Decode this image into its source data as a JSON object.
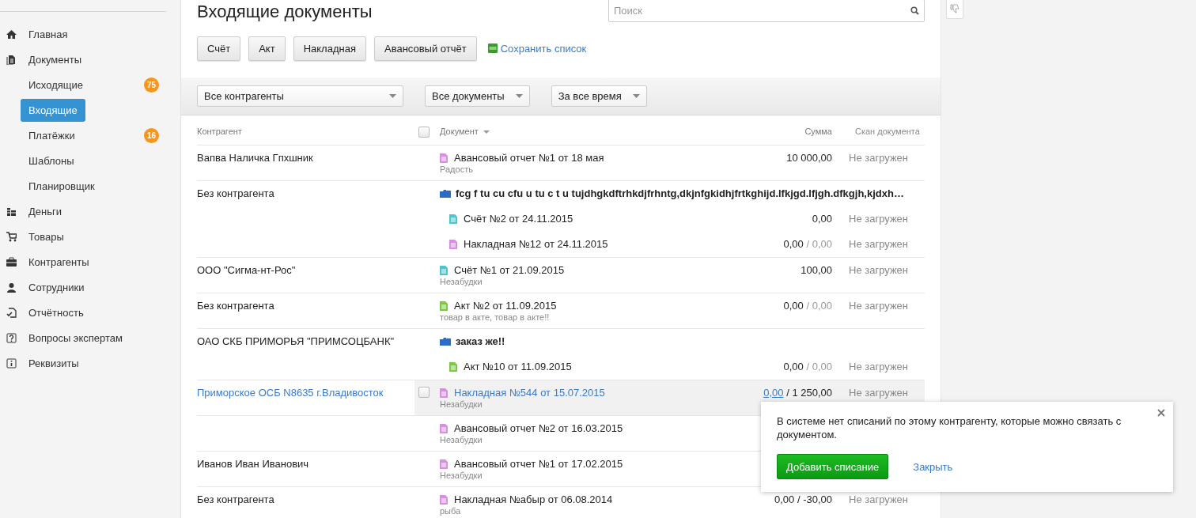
{
  "sidebar": {
    "items": [
      {
        "label": "Главная",
        "selected": false
      },
      {
        "label": "Документы",
        "selected": false,
        "children": [
          {
            "label": "Исходящие",
            "selected": false,
            "count": "75"
          },
          {
            "label": "Входящие",
            "selected": true
          },
          {
            "label": "Платёжки",
            "selected": false,
            "count": "16"
          },
          {
            "label": "Шаблоны",
            "selected": false
          },
          {
            "label": "Планировщик",
            "selected": false
          }
        ]
      },
      {
        "label": "Деньги",
        "selected": false
      },
      {
        "label": "Товары",
        "selected": false
      },
      {
        "label": "Контрагенты",
        "selected": false
      },
      {
        "label": "Сотрудники",
        "selected": false
      },
      {
        "label": "Отчётность",
        "selected": false
      },
      {
        "label": "Вопросы экспертам",
        "selected": false
      },
      {
        "label": "Реквизиты",
        "selected": false
      }
    ]
  },
  "page": {
    "title": "Входящие документы"
  },
  "search": {
    "placeholder": "Поиск"
  },
  "create_buttons": [
    "Счёт",
    "Акт",
    "Накладная",
    "Авансовый отчёт"
  ],
  "export_link": "Сохранить список",
  "filters": [
    "Все контрагенты",
    "Все документы",
    "За все время"
  ],
  "table": {
    "columns": [
      "Контрагент",
      "Документ",
      "Сумма",
      "Скан документа"
    ],
    "select_all_checked": false,
    "groups": [
      {
        "counterparty": "Вапва Наличка Гпхшник",
        "highlighted": false,
        "docs": [
          {
            "kind": "advance",
            "title": "Авансовый отчет №1 от 18 мая",
            "note": "Радость",
            "sum": "10 000,00",
            "scan": "Не загружен"
          }
        ]
      },
      {
        "counterparty": "Без контрагента",
        "highlighted": false,
        "docs": [
          {
            "kind": "folder",
            "title": "fcg f tu cu cfu u tu c t u tujdhgkdftrhkdjfrhntg,dkjnfgkidhjfrtkghijd.lfkjgd.lfjgh.dfkgjh,kjdxh…",
            "children": [
              {
                "kind": "invoice",
                "title": "Счёт №2 от 24.11.2015",
                "sum": "0,00",
                "scan": "Не загружен"
              },
              {
                "kind": "waybill",
                "title": "Накладная №12 от 24.11.2015",
                "sum": "0,00",
                "sum_total": "/ 0,00",
                "total_muted": true,
                "scan": "Не загружен"
              }
            ]
          }
        ]
      },
      {
        "counterparty": "ООО \"Сигма-нт-Рос\"",
        "highlighted": false,
        "docs": [
          {
            "kind": "invoice",
            "title": "Счёт №1 от 21.09.2015",
            "note": "Незабудки",
            "sum": "100,00",
            "scan": "Не загружен"
          }
        ]
      },
      {
        "counterparty": "Без контрагента",
        "highlighted": false,
        "docs": [
          {
            "kind": "act",
            "title": "Акт №2 от 11.09.2015",
            "note": "товар в акте, товар в акте!!",
            "sum": "0,00",
            "sum_total": "/ 0,00",
            "total_muted": true,
            "scan": "Не загружен"
          }
        ]
      },
      {
        "counterparty": "ОАО СКБ ПРИМОРЬЯ \"ПРИМСОЦБАНК\"",
        "highlighted": false,
        "docs": [
          {
            "kind": "folder",
            "title": "заказ же!!",
            "children": [
              {
                "kind": "act",
                "title": "Акт №10 от 11.09.2015",
                "sum": "0,00",
                "sum_total": "/ 0,00",
                "total_muted": true,
                "scan": "Не загружен"
              }
            ]
          }
        ]
      },
      {
        "counterparty": "Приморское ОСБ N8635 г.Владивосток",
        "highlighted": true,
        "docs": [
          {
            "kind": "waybill",
            "title": "Накладная №544 от 15.07.2015",
            "note": "Незабудки",
            "checked": false,
            "sum": "0,00",
            "sum_link": true,
            "sum_total": "/ 1 250,00",
            "total_muted": false,
            "scan": "Не загружен"
          }
        ]
      },
      {
        "highlighted": false,
        "docs": [
          {
            "kind": "advance",
            "title": "Авансовый отчет №2 от 16.03.2015",
            "note": "Незабудки"
          }
        ]
      },
      {
        "counterparty": "Иванов Иван Иванович",
        "highlighted": false,
        "docs": [
          {
            "kind": "advance",
            "title": "Авансовый отчет №1 от 17.02.2015",
            "note": "Незабудки"
          }
        ]
      },
      {
        "counterparty": "Без контрагента",
        "highlighted": false,
        "docs": [
          {
            "kind": "waybill",
            "title": "Накладная №абыр от 06.08.2014",
            "note": "рыба",
            "sum": "0,00",
            "sum_total": "/ -30,00",
            "total_muted": false,
            "scan": "Не загружен"
          }
        ]
      }
    ]
  },
  "popover": {
    "message": "В системе нет списаний по этому контрагенту, которые можно связать с документом.",
    "primary_button": "Добавить списание",
    "close_link": "Закрыть"
  }
}
